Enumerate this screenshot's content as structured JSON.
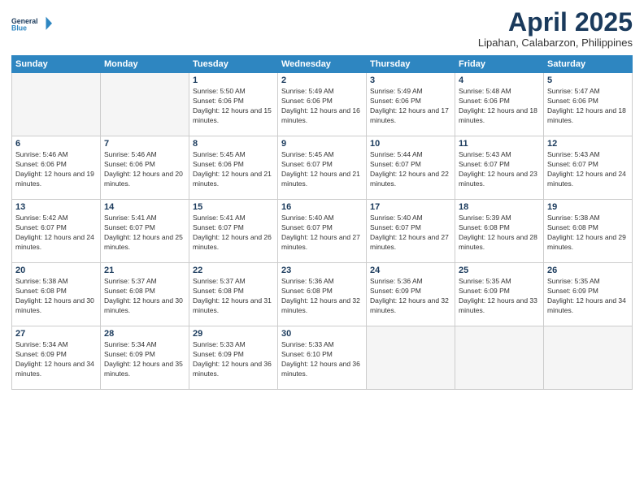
{
  "header": {
    "logo_line1": "General",
    "logo_line2": "Blue",
    "month_title": "April 2025",
    "location": "Lipahan, Calabarzon, Philippines"
  },
  "weekdays": [
    "Sunday",
    "Monday",
    "Tuesday",
    "Wednesday",
    "Thursday",
    "Friday",
    "Saturday"
  ],
  "days": [
    {
      "num": "",
      "sunrise": "",
      "sunset": "",
      "daylight": "",
      "empty": true
    },
    {
      "num": "",
      "sunrise": "",
      "sunset": "",
      "daylight": "",
      "empty": true
    },
    {
      "num": "1",
      "sunrise": "Sunrise: 5:50 AM",
      "sunset": "Sunset: 6:06 PM",
      "daylight": "Daylight: 12 hours and 15 minutes."
    },
    {
      "num": "2",
      "sunrise": "Sunrise: 5:49 AM",
      "sunset": "Sunset: 6:06 PM",
      "daylight": "Daylight: 12 hours and 16 minutes."
    },
    {
      "num": "3",
      "sunrise": "Sunrise: 5:49 AM",
      "sunset": "Sunset: 6:06 PM",
      "daylight": "Daylight: 12 hours and 17 minutes."
    },
    {
      "num": "4",
      "sunrise": "Sunrise: 5:48 AM",
      "sunset": "Sunset: 6:06 PM",
      "daylight": "Daylight: 12 hours and 18 minutes."
    },
    {
      "num": "5",
      "sunrise": "Sunrise: 5:47 AM",
      "sunset": "Sunset: 6:06 PM",
      "daylight": "Daylight: 12 hours and 18 minutes."
    },
    {
      "num": "6",
      "sunrise": "Sunrise: 5:46 AM",
      "sunset": "Sunset: 6:06 PM",
      "daylight": "Daylight: 12 hours and 19 minutes."
    },
    {
      "num": "7",
      "sunrise": "Sunrise: 5:46 AM",
      "sunset": "Sunset: 6:06 PM",
      "daylight": "Daylight: 12 hours and 20 minutes."
    },
    {
      "num": "8",
      "sunrise": "Sunrise: 5:45 AM",
      "sunset": "Sunset: 6:06 PM",
      "daylight": "Daylight: 12 hours and 21 minutes."
    },
    {
      "num": "9",
      "sunrise": "Sunrise: 5:45 AM",
      "sunset": "Sunset: 6:07 PM",
      "daylight": "Daylight: 12 hours and 21 minutes."
    },
    {
      "num": "10",
      "sunrise": "Sunrise: 5:44 AM",
      "sunset": "Sunset: 6:07 PM",
      "daylight": "Daylight: 12 hours and 22 minutes."
    },
    {
      "num": "11",
      "sunrise": "Sunrise: 5:43 AM",
      "sunset": "Sunset: 6:07 PM",
      "daylight": "Daylight: 12 hours and 23 minutes."
    },
    {
      "num": "12",
      "sunrise": "Sunrise: 5:43 AM",
      "sunset": "Sunset: 6:07 PM",
      "daylight": "Daylight: 12 hours and 24 minutes."
    },
    {
      "num": "13",
      "sunrise": "Sunrise: 5:42 AM",
      "sunset": "Sunset: 6:07 PM",
      "daylight": "Daylight: 12 hours and 24 minutes."
    },
    {
      "num": "14",
      "sunrise": "Sunrise: 5:41 AM",
      "sunset": "Sunset: 6:07 PM",
      "daylight": "Daylight: 12 hours and 25 minutes."
    },
    {
      "num": "15",
      "sunrise": "Sunrise: 5:41 AM",
      "sunset": "Sunset: 6:07 PM",
      "daylight": "Daylight: 12 hours and 26 minutes."
    },
    {
      "num": "16",
      "sunrise": "Sunrise: 5:40 AM",
      "sunset": "Sunset: 6:07 PM",
      "daylight": "Daylight: 12 hours and 27 minutes."
    },
    {
      "num": "17",
      "sunrise": "Sunrise: 5:40 AM",
      "sunset": "Sunset: 6:07 PM",
      "daylight": "Daylight: 12 hours and 27 minutes."
    },
    {
      "num": "18",
      "sunrise": "Sunrise: 5:39 AM",
      "sunset": "Sunset: 6:08 PM",
      "daylight": "Daylight: 12 hours and 28 minutes."
    },
    {
      "num": "19",
      "sunrise": "Sunrise: 5:38 AM",
      "sunset": "Sunset: 6:08 PM",
      "daylight": "Daylight: 12 hours and 29 minutes."
    },
    {
      "num": "20",
      "sunrise": "Sunrise: 5:38 AM",
      "sunset": "Sunset: 6:08 PM",
      "daylight": "Daylight: 12 hours and 30 minutes."
    },
    {
      "num": "21",
      "sunrise": "Sunrise: 5:37 AM",
      "sunset": "Sunset: 6:08 PM",
      "daylight": "Daylight: 12 hours and 30 minutes."
    },
    {
      "num": "22",
      "sunrise": "Sunrise: 5:37 AM",
      "sunset": "Sunset: 6:08 PM",
      "daylight": "Daylight: 12 hours and 31 minutes."
    },
    {
      "num": "23",
      "sunrise": "Sunrise: 5:36 AM",
      "sunset": "Sunset: 6:08 PM",
      "daylight": "Daylight: 12 hours and 32 minutes."
    },
    {
      "num": "24",
      "sunrise": "Sunrise: 5:36 AM",
      "sunset": "Sunset: 6:09 PM",
      "daylight": "Daylight: 12 hours and 32 minutes."
    },
    {
      "num": "25",
      "sunrise": "Sunrise: 5:35 AM",
      "sunset": "Sunset: 6:09 PM",
      "daylight": "Daylight: 12 hours and 33 minutes."
    },
    {
      "num": "26",
      "sunrise": "Sunrise: 5:35 AM",
      "sunset": "Sunset: 6:09 PM",
      "daylight": "Daylight: 12 hours and 34 minutes."
    },
    {
      "num": "27",
      "sunrise": "Sunrise: 5:34 AM",
      "sunset": "Sunset: 6:09 PM",
      "daylight": "Daylight: 12 hours and 34 minutes."
    },
    {
      "num": "28",
      "sunrise": "Sunrise: 5:34 AM",
      "sunset": "Sunset: 6:09 PM",
      "daylight": "Daylight: 12 hours and 35 minutes."
    },
    {
      "num": "29",
      "sunrise": "Sunrise: 5:33 AM",
      "sunset": "Sunset: 6:09 PM",
      "daylight": "Daylight: 12 hours and 36 minutes."
    },
    {
      "num": "30",
      "sunrise": "Sunrise: 5:33 AM",
      "sunset": "Sunset: 6:10 PM",
      "daylight": "Daylight: 12 hours and 36 minutes."
    },
    {
      "num": "",
      "sunrise": "",
      "sunset": "",
      "daylight": "",
      "empty": true
    },
    {
      "num": "",
      "sunrise": "",
      "sunset": "",
      "daylight": "",
      "empty": true
    }
  ]
}
